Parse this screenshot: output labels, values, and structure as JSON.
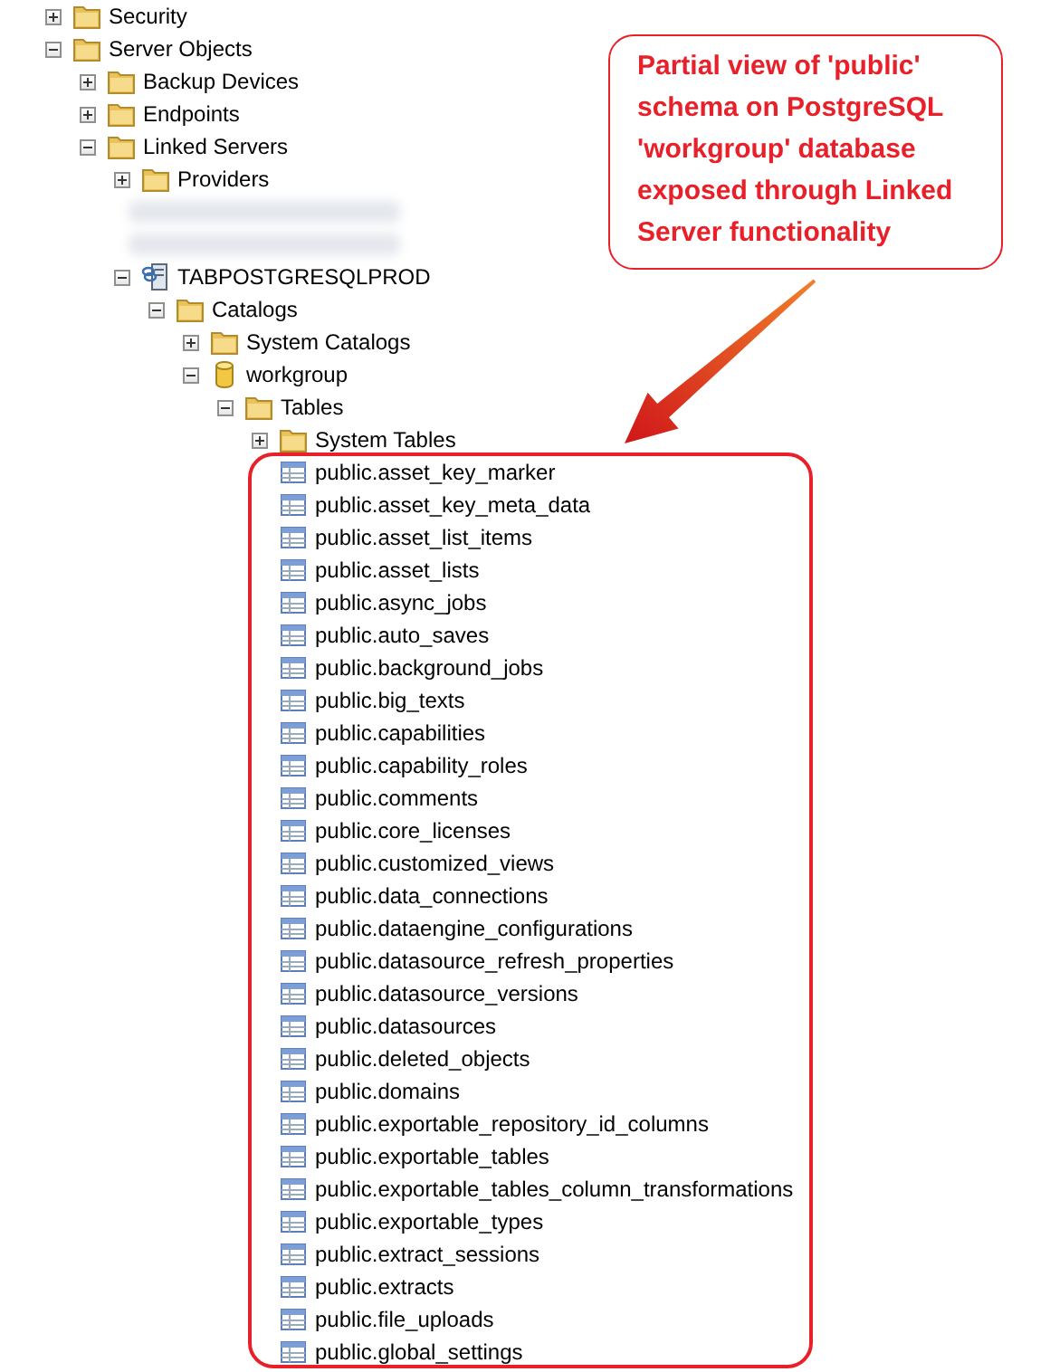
{
  "tree": [
    {
      "label": "Security",
      "kind": "folder",
      "expanded": false
    },
    {
      "label": "Server Objects",
      "kind": "folder",
      "expanded": true,
      "children": [
        {
          "label": "Backup Devices",
          "kind": "folder",
          "expanded": false
        },
        {
          "label": "Endpoints",
          "kind": "folder",
          "expanded": false
        },
        {
          "label": "Linked Servers",
          "kind": "folder",
          "expanded": true,
          "children": [
            {
              "label": "Providers",
              "kind": "folder",
              "expanded": false
            },
            {
              "kind": "redacted"
            },
            {
              "kind": "redacted"
            },
            {
              "label": "TABPOSTGRESQLPROD",
              "kind": "linked-server",
              "expanded": true,
              "children": [
                {
                  "label": "Catalogs",
                  "kind": "folder",
                  "expanded": true,
                  "children": [
                    {
                      "label": "System Catalogs",
                      "kind": "folder",
                      "expanded": false
                    },
                    {
                      "label": "workgroup",
                      "kind": "database",
                      "expanded": true,
                      "children": [
                        {
                          "label": "Tables",
                          "kind": "folder",
                          "expanded": true,
                          "children": [
                            {
                              "label": "System Tables",
                              "kind": "folder",
                              "expanded": false
                            },
                            {
                              "label": "public.asset_key_marker",
                              "kind": "table"
                            },
                            {
                              "label": "public.asset_key_meta_data",
                              "kind": "table"
                            },
                            {
                              "label": "public.asset_list_items",
                              "kind": "table"
                            },
                            {
                              "label": "public.asset_lists",
                              "kind": "table"
                            },
                            {
                              "label": "public.async_jobs",
                              "kind": "table"
                            },
                            {
                              "label": "public.auto_saves",
                              "kind": "table"
                            },
                            {
                              "label": "public.background_jobs",
                              "kind": "table"
                            },
                            {
                              "label": "public.big_texts",
                              "kind": "table"
                            },
                            {
                              "label": "public.capabilities",
                              "kind": "table"
                            },
                            {
                              "label": "public.capability_roles",
                              "kind": "table"
                            },
                            {
                              "label": "public.comments",
                              "kind": "table"
                            },
                            {
                              "label": "public.core_licenses",
                              "kind": "table"
                            },
                            {
                              "label": "public.customized_views",
                              "kind": "table"
                            },
                            {
                              "label": "public.data_connections",
                              "kind": "table"
                            },
                            {
                              "label": "public.dataengine_configurations",
                              "kind": "table"
                            },
                            {
                              "label": "public.datasource_refresh_properties",
                              "kind": "table"
                            },
                            {
                              "label": "public.datasource_versions",
                              "kind": "table"
                            },
                            {
                              "label": "public.datasources",
                              "kind": "table"
                            },
                            {
                              "label": "public.deleted_objects",
                              "kind": "table"
                            },
                            {
                              "label": "public.domains",
                              "kind": "table"
                            },
                            {
                              "label": "public.exportable_repository_id_columns",
                              "kind": "table"
                            },
                            {
                              "label": "public.exportable_tables",
                              "kind": "table"
                            },
                            {
                              "label": "public.exportable_tables_column_transformations",
                              "kind": "table"
                            },
                            {
                              "label": "public.exportable_types",
                              "kind": "table"
                            },
                            {
                              "label": "public.extract_sessions",
                              "kind": "table"
                            },
                            {
                              "label": "public.extracts",
                              "kind": "table"
                            },
                            {
                              "label": "public.file_uploads",
                              "kind": "table"
                            },
                            {
                              "label": "public.global_settings",
                              "kind": "table"
                            }
                          ]
                        }
                      ]
                    }
                  ]
                }
              ]
            }
          ]
        }
      ]
    }
  ],
  "callout": {
    "text": "Partial view of 'public' schema on PostgreSQL 'workgroup' database exposed through Linked Server functionality"
  }
}
